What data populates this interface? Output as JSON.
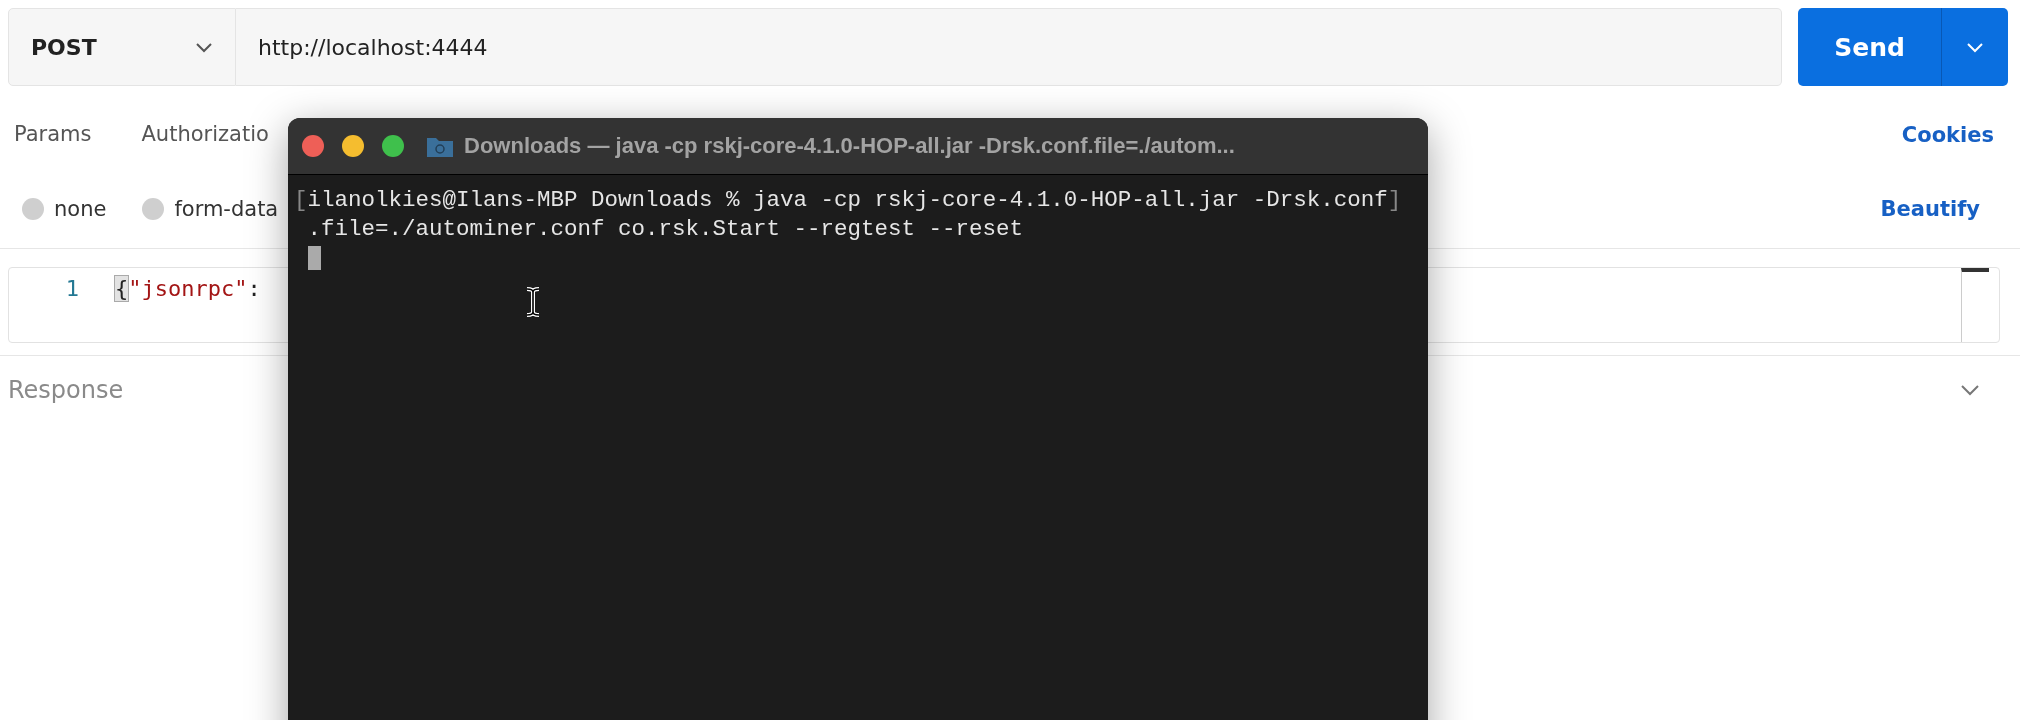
{
  "request": {
    "method": "POST",
    "url": "http://localhost:4444",
    "send_label": "Send"
  },
  "tabs": [
    {
      "label": "Params",
      "selected": false
    },
    {
      "label": "Authorizatio",
      "selected": false
    }
  ],
  "cookies_link": "Cookies",
  "body_types": [
    {
      "label": "none",
      "selected": false
    },
    {
      "label": "form-data",
      "selected": false
    }
  ],
  "beautify_link": "Beautify",
  "editor": {
    "lines": [
      {
        "number": "1",
        "tokens": [
          {
            "kind": "brace",
            "text": "{"
          },
          {
            "kind": "string",
            "text": "\"jsonrpc\""
          },
          {
            "kind": "punct",
            "text": ":"
          }
        ]
      }
    ]
  },
  "response": {
    "title": "Response"
  },
  "terminal": {
    "title": "Downloads — java -cp rskj-core-4.1.0-HOP-all.jar -Drsk.conf.file=./autom...",
    "lines": [
      {
        "open_mark": "[",
        "text": "ilanolkies@Ilans-MBP Downloads % java -cp rskj-core-4.1.0-HOP-all.jar -Drsk.conf",
        "close_mark": "]"
      },
      {
        "text": ".file=./autominer.conf co.rsk.Start --regtest --reset"
      }
    ],
    "cursor": true
  }
}
